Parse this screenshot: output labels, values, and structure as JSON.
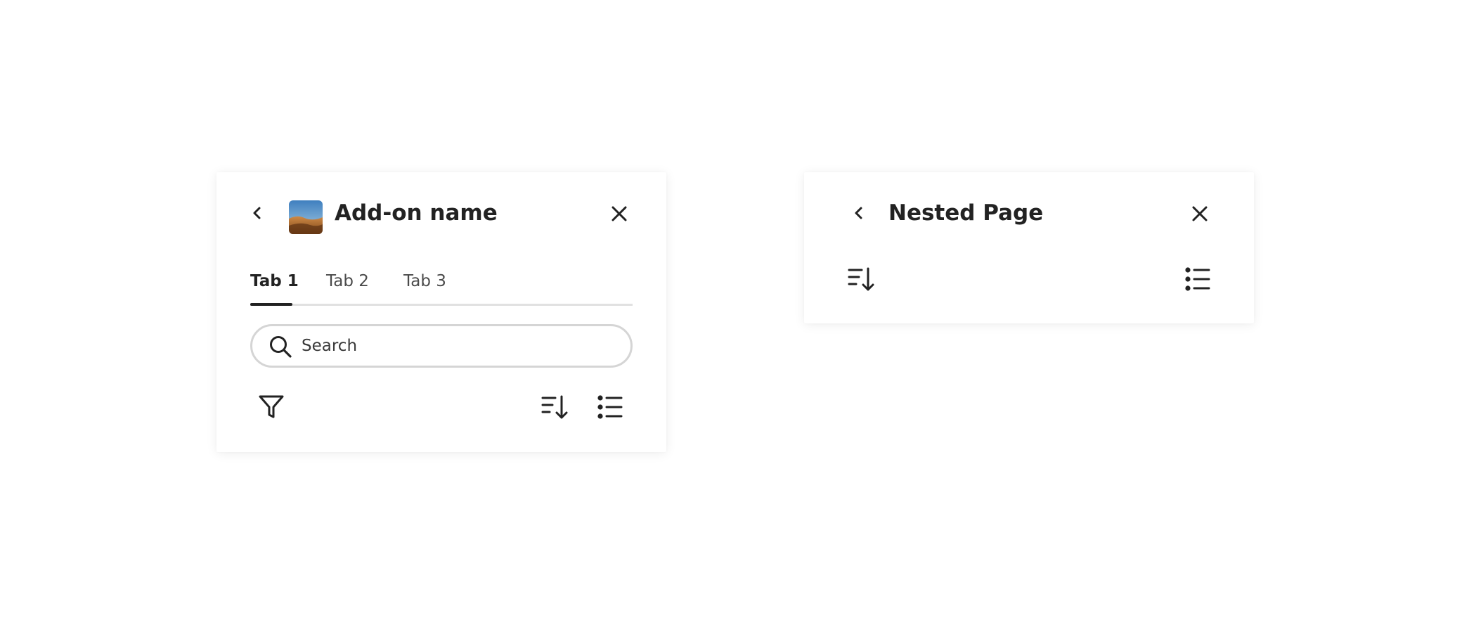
{
  "left_panel": {
    "title": "Add-on name",
    "back_icon": "chevron-left-icon",
    "close_icon": "close-icon",
    "thumbnail": "desert-dunes-image",
    "tabs": [
      {
        "label": "Tab 1",
        "selected": true
      },
      {
        "label": "Tab 2",
        "selected": false
      },
      {
        "label": "Tab 3",
        "selected": false
      }
    ],
    "search": {
      "placeholder": "Search",
      "value": "",
      "icon": "search-icon"
    },
    "toolbar": {
      "filter_icon": "filter-icon",
      "sort_icon": "sort-descending-icon",
      "list_icon": "bulleted-list-icon"
    }
  },
  "right_panel": {
    "title": "Nested Page",
    "back_icon": "chevron-left-icon",
    "close_icon": "close-icon",
    "toolbar": {
      "sort_icon": "sort-descending-icon",
      "list_icon": "bulleted-list-icon"
    }
  },
  "colors": {
    "text": "#222222",
    "tab_track": "#e1e1e1",
    "search_border": "#d5d5d5",
    "background": "#ffffff"
  }
}
